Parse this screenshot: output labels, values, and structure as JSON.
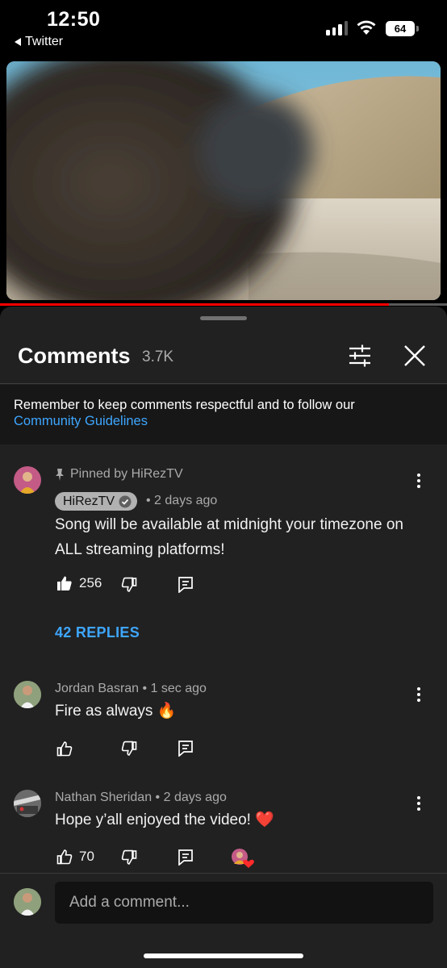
{
  "status": {
    "time": "12:50",
    "back_app": "Twitter",
    "battery": "64"
  },
  "video": {
    "progress": 0.87
  },
  "comments_panel": {
    "title": "Comments",
    "count": "3.7K",
    "notice_text": "Remember to keep comments respectful and to follow our",
    "notice_link": "Community Guidelines"
  },
  "pinned_comment": {
    "pinned_label": "Pinned by HiRezTV",
    "author": "HiRezTV",
    "time": "• 2 days ago",
    "text": "Song will be available at midnight your timezone on ALL streaming platforms!",
    "likes": "256",
    "replies": "42 REPLIES"
  },
  "comments": [
    {
      "author": "Jordan Basran",
      "time": "• 1 sec ago",
      "text": "Fire as always",
      "emoji": "🔥",
      "likes": ""
    },
    {
      "author": "Nathan Sheridan",
      "time": "• 2 days ago",
      "text": "Hope y’all enjoyed the video!",
      "emoji": "❤️",
      "likes": "70"
    }
  ],
  "add_comment": {
    "placeholder": "Add a comment..."
  },
  "colors": {
    "accent_link": "#3ea6ff",
    "progress_red": "#ff0000",
    "sheet_bg": "#212121"
  }
}
